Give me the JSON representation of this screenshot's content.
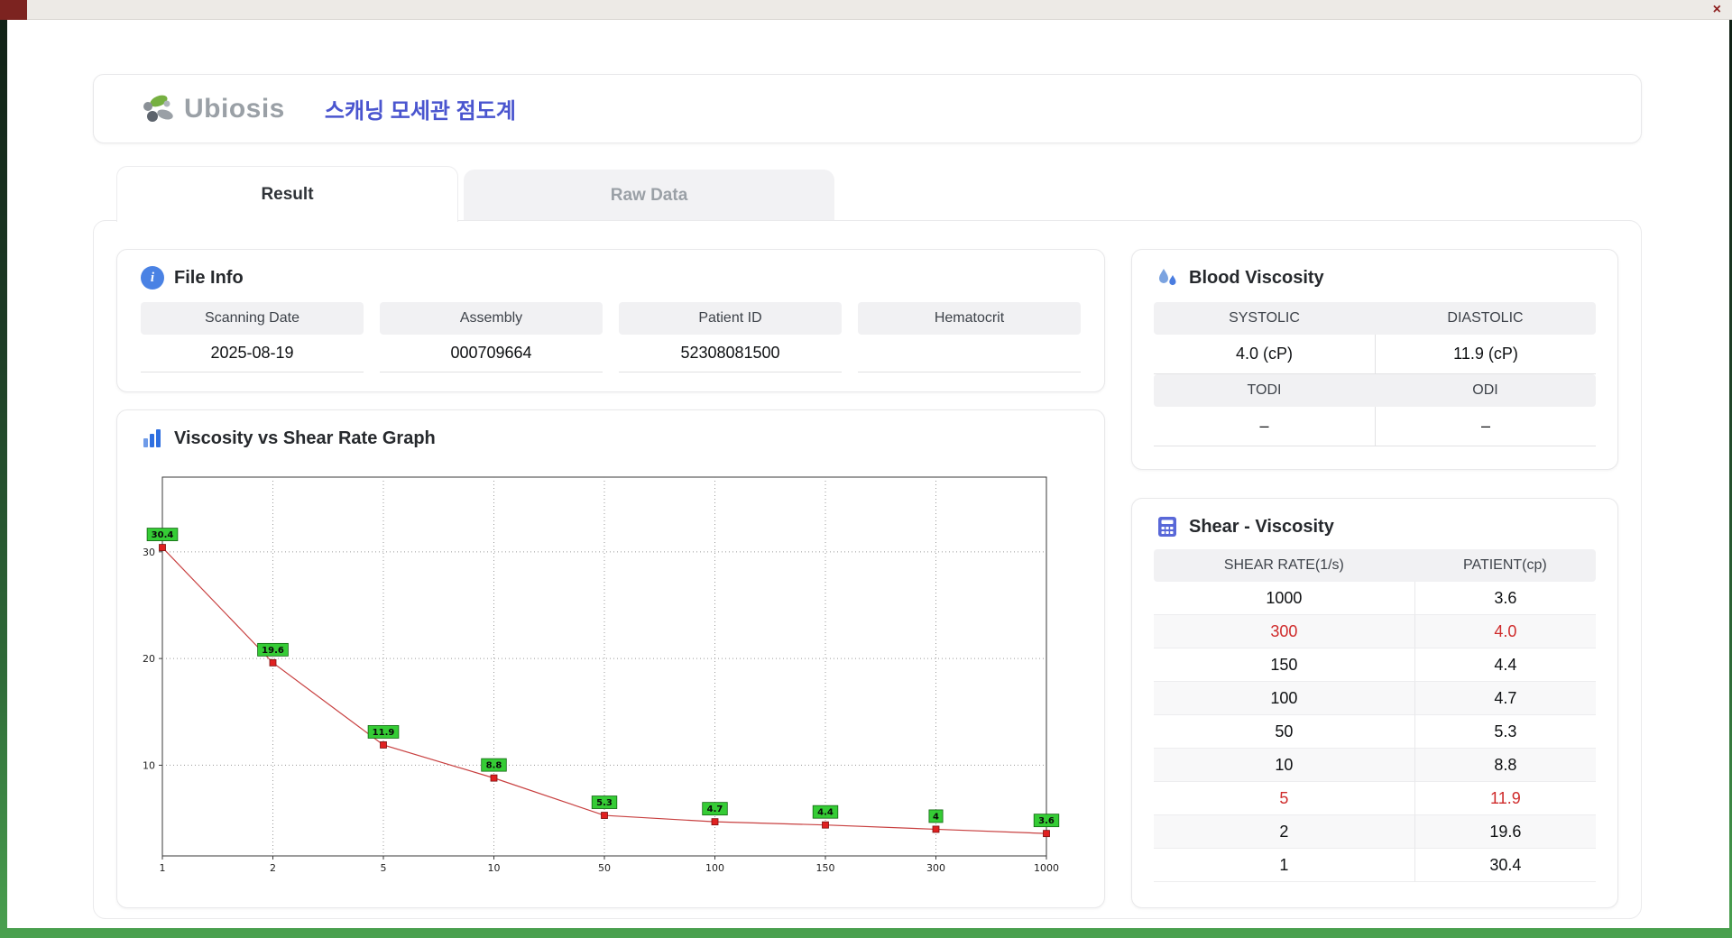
{
  "window": {
    "close_label": "×"
  },
  "header": {
    "logo_text": "Ubiosis",
    "title": "스캐닝 모세관 점도계"
  },
  "tabs": [
    {
      "label": "Result",
      "active": true
    },
    {
      "label": "Raw Data",
      "active": false
    }
  ],
  "file_info": {
    "title": "File Info",
    "fields": [
      {
        "label": "Scanning Date",
        "value": "2025-08-19"
      },
      {
        "label": "Assembly",
        "value": "000709664"
      },
      {
        "label": "Patient ID",
        "value": "52308081500"
      },
      {
        "label": "Hematocrit",
        "value": ""
      }
    ]
  },
  "graph": {
    "title": "Viscosity vs Shear Rate Graph"
  },
  "chart_data": {
    "type": "line",
    "title": "Viscosity vs Shear Rate Graph",
    "xlabel": "",
    "ylabel": "",
    "x_axis_type": "category",
    "categories": [
      1,
      2,
      5,
      10,
      50,
      100,
      150,
      300,
      1000
    ],
    "category_labels": [
      "1",
      "2",
      "5",
      "10",
      "50",
      "100",
      "150",
      "300",
      "1000"
    ],
    "values": [
      30.4,
      19.6,
      11.9,
      8.8,
      5.3,
      4.7,
      4.4,
      4,
      3.6
    ],
    "point_labels": [
      "30.4",
      "19.6",
      "11.9",
      "8.8",
      "5.3",
      "4.7",
      "4.4",
      "4",
      "3.6"
    ],
    "yticks": [
      10,
      20,
      30
    ],
    "ylim": [
      1.5,
      37
    ],
    "grid": "dotted",
    "line_color": "#c84040",
    "marker_color": "#e02020",
    "marker_stroke": "#7a0f0f",
    "label_bg": "#35cc35",
    "label_border": "#116611",
    "legend": "none"
  },
  "blood_viscosity": {
    "title": "Blood Viscosity",
    "rows": [
      {
        "labels": [
          "SYSTOLIC",
          "DIASTOLIC"
        ],
        "values": [
          "4.0 (cP)",
          "11.9 (cP)"
        ]
      },
      {
        "labels": [
          "TODI",
          "ODI"
        ],
        "values": [
          "–",
          "–"
        ]
      }
    ]
  },
  "shear_viscosity": {
    "title": "Shear - Viscosity",
    "columns": [
      "SHEAR RATE(1/s)",
      "PATIENT(cp)"
    ],
    "rows": [
      {
        "shear": "1000",
        "patient": "3.6",
        "highlight": false
      },
      {
        "shear": "300",
        "patient": "4.0",
        "highlight": true
      },
      {
        "shear": "150",
        "patient": "4.4",
        "highlight": false
      },
      {
        "shear": "100",
        "patient": "4.7",
        "highlight": false
      },
      {
        "shear": "50",
        "patient": "5.3",
        "highlight": false
      },
      {
        "shear": "10",
        "patient": "8.8",
        "highlight": false
      },
      {
        "shear": "5",
        "patient": "11.9",
        "highlight": true
      },
      {
        "shear": "2",
        "patient": "19.6",
        "highlight": false
      },
      {
        "shear": "1",
        "patient": "30.4",
        "highlight": false
      }
    ]
  },
  "colors": {
    "accent_blue": "#4a55cf",
    "icon_blue": "#4a82e4",
    "highlight_red": "#cf2b2b",
    "header_strip": "#f1f1f3"
  }
}
